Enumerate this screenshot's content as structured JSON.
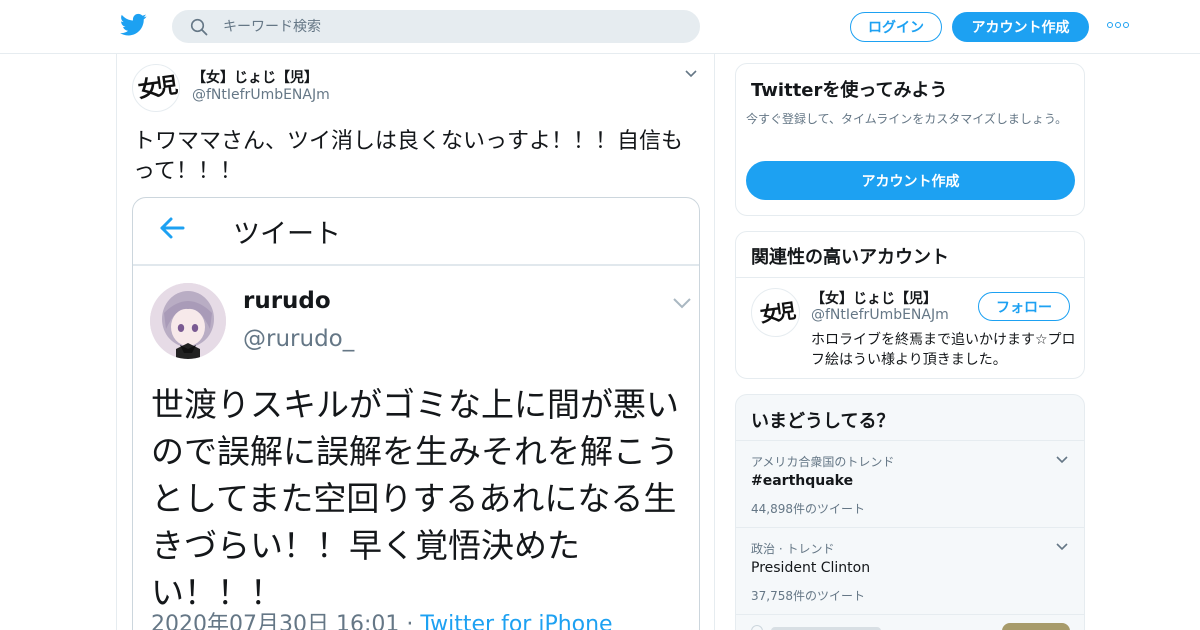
{
  "colors": {
    "accent": "#1da1f2",
    "text": "#14171a",
    "muted": "#657786",
    "border": "#e6ecf0"
  },
  "header": {
    "logo_icon": "twitter-bird-icon",
    "search_placeholder": "キーワード検索",
    "login_label": "ログイン",
    "signup_label": "アカウント作成",
    "more_icon": "more-dots-icon"
  },
  "tweet": {
    "display_name": "【女】じょじ【児】",
    "handle": "@fNtIefrUmbENAJm",
    "text": "トワママさん、ツイ消しは良くないっすよ！！！自信もって！！！",
    "avatar_logo": "女児"
  },
  "embedded": {
    "header_title": "ツイート",
    "name": "rurudo",
    "handle": "@rurudo_",
    "text": "世渡りスキルがゴミな上に間が悪いので誤解に誤解を生みそれを解こうとしてまた空回りするあれになる生きづらい！！早く覚悟決めたい！！！",
    "date": "2020年07月30日 16:01",
    "separator": " · ",
    "source": "Twitter for iPhone"
  },
  "sidebar": {
    "signup_card": {
      "title": "Twitterを使ってみよう",
      "subtitle": "今すぐ登録して、タイムラインをカスタマイズしましょう。",
      "button": "アカウント作成"
    },
    "related_card": {
      "title": "関連性の高いアカウント",
      "account_name": "【女】じょじ【児】",
      "account_handle": "@fNtIefrUmbENAJm",
      "follow_label": "フォロー",
      "bio": "ホロライブを終焉まで追いかけます☆プロフ絵はうい様より頂きました。"
    },
    "trends_card": {
      "title": "いまどうしてる？",
      "trends": [
        {
          "context": "アメリカ合衆国のトレンド",
          "name": "#earthquake",
          "count": "44,898件のツイート"
        },
        {
          "context": "政治 · トレンド",
          "name": "President Clinton",
          "count": "37,758件のツイート"
        }
      ]
    }
  }
}
